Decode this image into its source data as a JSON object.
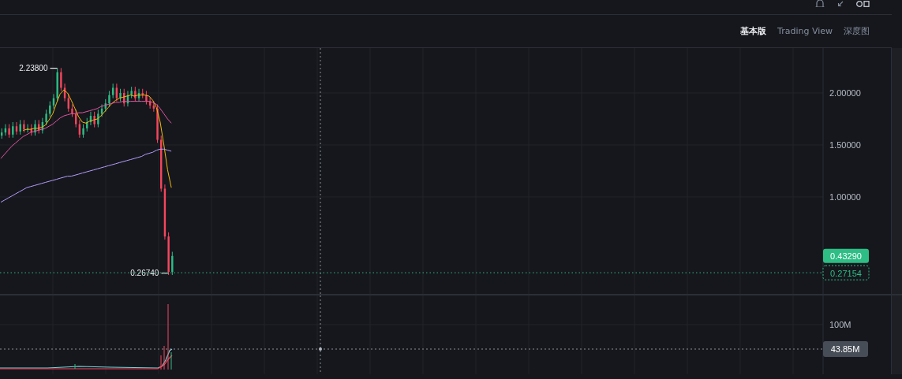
{
  "toolbar": {
    "tabs": [
      {
        "label": "基本版",
        "selected": true
      },
      {
        "label": "Trading View",
        "selected": false
      },
      {
        "label": "深度图",
        "selected": false
      }
    ]
  },
  "chart": {
    "y_axis_labels": [
      "2.00000",
      "1.50000",
      "1.00000"
    ],
    "markers": [
      {
        "kind": "high",
        "label": "2.23800"
      },
      {
        "kind": "low",
        "label": "0.26740"
      }
    ],
    "price_tags": [
      {
        "kind": "last",
        "label": "0.43290"
      },
      {
        "kind": "current",
        "label": "0.27154"
      }
    ]
  },
  "volume": {
    "axis_label": "100M",
    "crosshair_label": "43.85M"
  }
}
